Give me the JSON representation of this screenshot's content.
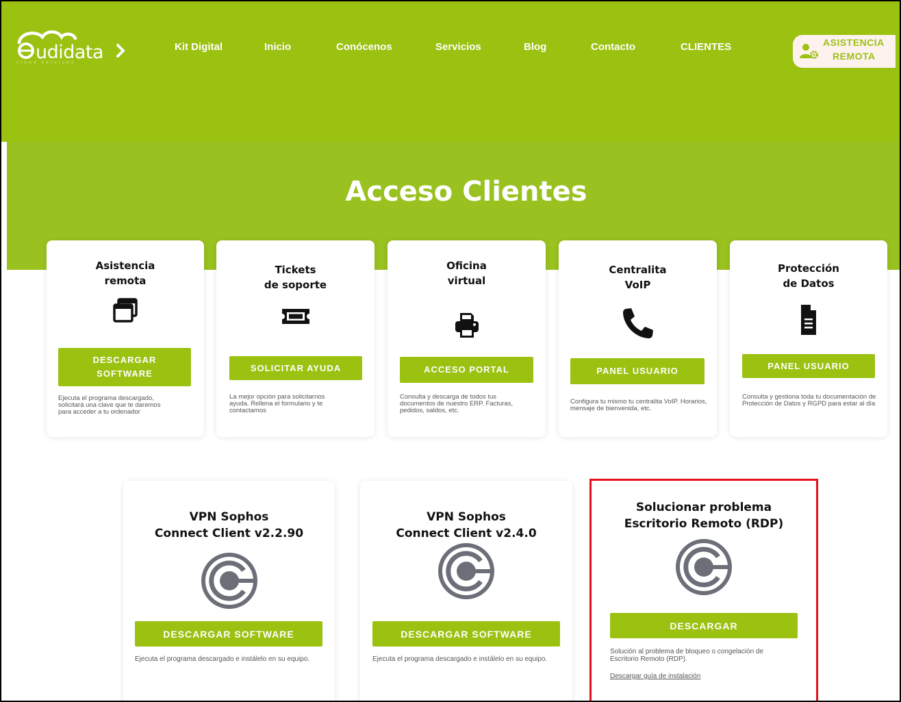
{
  "brand": {
    "logo_text": "audidata",
    "logo_sub": "cloud services",
    "accent": "#9bc111",
    "highlight": "#e5101b"
  },
  "nav": {
    "items": [
      "Kit Digital",
      "Inicio",
      "Conócenos",
      "Servicios",
      "Blog",
      "Contacto",
      "CLIENTES"
    ],
    "remote_button": {
      "line1": "ASISTENCIA",
      "line2": "REMOTA",
      "icon": "user-gear-icon"
    }
  },
  "hero": {
    "title": "Acceso Clientes"
  },
  "cards": [
    {
      "title_l1": "Asistencia",
      "title_l2": "remota",
      "icon": "windows-icon",
      "button_l1": "DESCARGAR",
      "button_l2": "SOFTWARE",
      "desc": "Ejecuta el programa descargado, solicitará una clave que te daremos para acceder a tu ordenador"
    },
    {
      "title_l1": "Tickets",
      "title_l2": "de soporte",
      "icon": "ticket-icon",
      "button": "SOLICITAR AYUDA",
      "desc": "La mejor opción para solicitarnos ayuda. Rellena el formulario y te contactamos"
    },
    {
      "title_l1": "Oficina",
      "title_l2": "virtual",
      "icon": "printer-icon",
      "button": "ACCESO PORTAL",
      "desc": "Consulta y descarga de todos tus documentos de nuestro ERP. Facturas, pedidos, saldos, etc."
    },
    {
      "title_l1": "Centralita",
      "title_l2": "VoIP",
      "icon": "phone-icon",
      "button": "PANEL USUARIO",
      "desc": "Configura tu mismo tu centralita VoIP. Horarios, mensaje de bienvenida, etc."
    },
    {
      "title_l1": "Protección",
      "title_l2": "de Datos",
      "icon": "document-icon",
      "button": "PANEL USUARIO",
      "desc": "Consulta y gestiona toda tu documentación de Protección de Datos y RGPD para estar al día"
    }
  ],
  "downloads": [
    {
      "title_l1": "VPN Sophos",
      "title_l2": "Connect Client v2.2.90",
      "icon": "sophos-connect-icon",
      "button": "DESCARGAR SOFTWARE",
      "desc": "Ejecuta el programa descargado e instálelo en su equipo."
    },
    {
      "title_l1": "VPN Sophos",
      "title_l2": "Connect Client v2.4.0",
      "icon": "sophos-connect-icon",
      "button": "DESCARGAR SOFTWARE",
      "desc": "Ejecuta el programa descargado e instálelo en su equipo."
    },
    {
      "title_l1": "Solucionar problema",
      "title_l2": "Escritorio Remoto (RDP)",
      "icon": "sophos-connect-icon",
      "button": "DESCARGAR",
      "desc": "Solución al problema de bloqueo o congelación de Escritorio Remoto (RDP).",
      "link": "Descargar guía de instalación"
    }
  ]
}
